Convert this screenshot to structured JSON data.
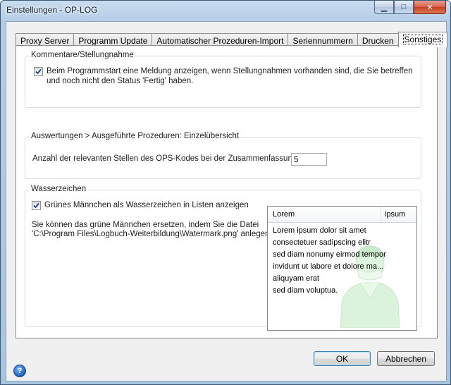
{
  "window": {
    "title": "Einstellungen - OP-LOG",
    "minimize_label": "▁",
    "maximize_label": "□",
    "close_label": "✕"
  },
  "tabs": [
    {
      "label": "Proxy Server"
    },
    {
      "label": "Programm Update"
    },
    {
      "label": "Automatischer Prozeduren-Import"
    },
    {
      "label": "Seriennummern"
    },
    {
      "label": "Drucken"
    },
    {
      "label": "Sonstiges",
      "active": true
    }
  ],
  "comments_group": {
    "legend": "Kommentare/Stellungnahme",
    "checkbox_checked": true,
    "checkbox_text_line1": "Beim Programmstart eine Meldung anzeigen, wenn Stellungnahmen vorhanden sind, die Sie betreffen",
    "checkbox_text_line2": "und noch nicht den Status 'Fertig' haben."
  },
  "analysis_group": {
    "legend": "Auswertungen > Ausgeführte Prozeduren: Einzelübersicht",
    "label": "Anzahl der relevanten Stellen des OPS-Kodes bei der Zusammenfassung:",
    "value": "5"
  },
  "watermark_group": {
    "legend": "Wasserzeichen",
    "checkbox_checked": true,
    "checkbox_text": "Grünes Männchen als Wasserzeichen in Listen anzeigen",
    "info_line1": "Sie können das grüne Männchen ersetzen, indem Sie die Datei",
    "info_line2": "'C:\\Program Files\\Logbuch-Weiterbildung\\Watermark.png' anlegen",
    "preview": {
      "columns": [
        "Lorem",
        "ipsum"
      ],
      "rows": [
        "Lorem ipsum dolor sit amet",
        "consectetuer sadipscing elitr",
        "sed diam nonumy eirmod tempor",
        "invidunt ut labore et dolore ma...",
        "aliquyam erat",
        "sed diam voluptua."
      ]
    }
  },
  "buttons": {
    "ok": "OK",
    "cancel": "Abbrechen",
    "help": "?"
  },
  "colors": {
    "watermark_green": "#8fd48f",
    "checkmark": "#1c3f94"
  }
}
